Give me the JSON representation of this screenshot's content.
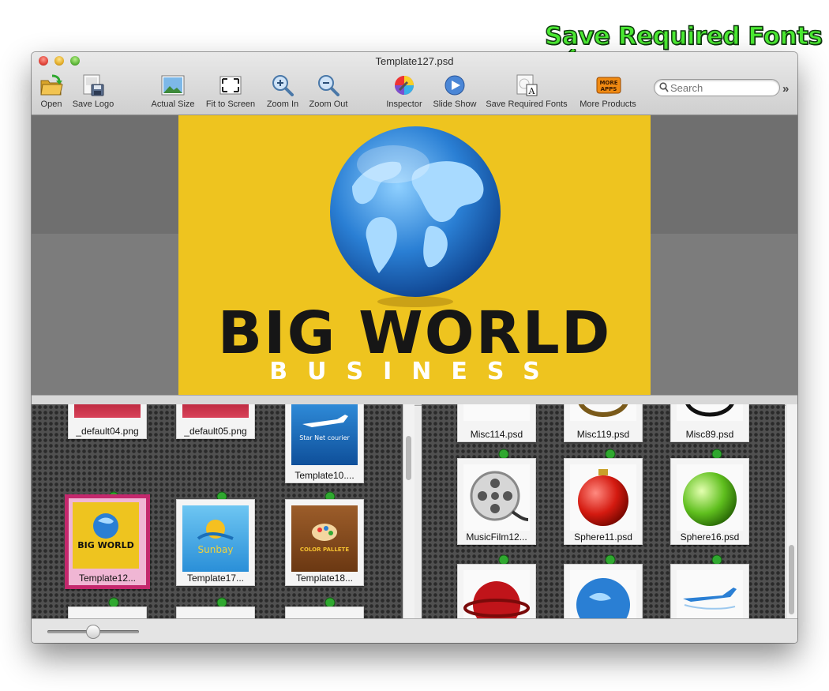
{
  "annotation": {
    "text": "Save Required Fonts",
    "color": "#4bea32"
  },
  "window": {
    "title": "Template127.psd"
  },
  "toolbar": {
    "items": [
      {
        "label": "Open",
        "icon": "open-folder-icon"
      },
      {
        "label": "Save Logo",
        "icon": "save-logo-icon"
      },
      {
        "label": "Actual Size",
        "icon": "actual-size-icon"
      },
      {
        "label": "Fit to Screen",
        "icon": "fit-to-screen-icon"
      },
      {
        "label": "Zoom In",
        "icon": "zoom-in-icon"
      },
      {
        "label": "Zoom Out",
        "icon": "zoom-out-icon"
      },
      {
        "label": "Inspector",
        "icon": "inspector-color-wheel-icon"
      },
      {
        "label": "Slide Show",
        "icon": "slide-show-play-icon"
      },
      {
        "label": "Save Required Fonts",
        "icon": "save-required-fonts-icon"
      },
      {
        "label": "More Products",
        "icon": "more-apps-icon",
        "badge": "MORE APPS"
      }
    ],
    "search_placeholder": "Search"
  },
  "preview": {
    "logo_title": "BIG WORLD",
    "logo_subtitle": "BUSINESS",
    "background": "#eec41f"
  },
  "left_pane": {
    "items": [
      {
        "name": "_default04.png",
        "thumb": "red-web-banner",
        "selected": false
      },
      {
        "name": "_default05.png",
        "thumb": "red-web-banner",
        "selected": false
      },
      {
        "name": "Template10....",
        "thumb": "star-net-courier",
        "thumb_text": "Star Net courier",
        "selected": false
      },
      {
        "name": "Template12...",
        "thumb": "big-world-logo",
        "thumb_text": "BIG WORLD",
        "selected": true
      },
      {
        "name": "Template17...",
        "thumb": "sunbay-logo",
        "thumb_text": "Sunbay",
        "selected": false
      },
      {
        "name": "Template18...",
        "thumb": "color-pallete-logo",
        "thumb_text": "COLOR PALLETE",
        "selected": false
      }
    ]
  },
  "right_pane": {
    "items": [
      {
        "name": "Misc114.psd",
        "thumb": "misc"
      },
      {
        "name": "Misc119.psd",
        "thumb": "misc"
      },
      {
        "name": "Misc89.psd",
        "thumb": "misc"
      },
      {
        "name": "MusicFilm12...",
        "thumb": "film-reel"
      },
      {
        "name": "Sphere11.psd",
        "thumb": "red-ornament"
      },
      {
        "name": "Sphere16.psd",
        "thumb": "green-sphere"
      }
    ]
  },
  "colors": {
    "selection": "#c4286d",
    "pin": "#2fa82f"
  }
}
